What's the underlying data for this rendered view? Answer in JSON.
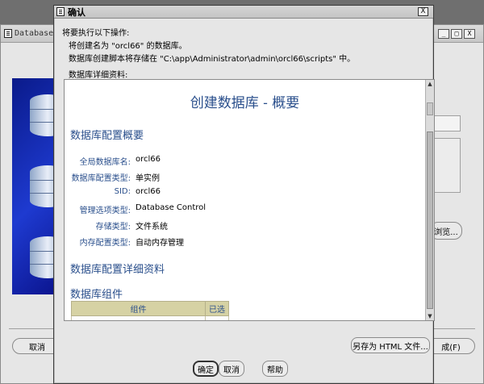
{
  "background_window": {
    "title": "Database",
    "window_controls": [
      "_",
      "□",
      "X"
    ],
    "browse_label": "浏览...",
    "cancel_label": "取消",
    "finish_label": "成(F)"
  },
  "dialog": {
    "title": "确认",
    "close_label": "X",
    "intro_line1": "将要执行以下操作:",
    "intro_line2": "将创建名为 \"orcl66\" 的数据库。",
    "intro_line3": "数据库创建脚本将存储在 \"C:\\app\\Administrator\\admin\\orcl66\\scripts\" 中。",
    "details_caption": "数据库详细资料:",
    "summary": {
      "title": "创建数据库 - 概要",
      "section1": "数据库配置概要",
      "rows": [
        {
          "key": "全局数据库名:",
          "value": "orcl66"
        },
        {
          "key": "数据库配置类型:",
          "value": "单实例"
        },
        {
          "key": "SID:",
          "value": "orcl66"
        },
        {
          "key": "管理选项类型:",
          "value": "Database Control"
        },
        {
          "key": "存储类型:",
          "value": "文件系统"
        },
        {
          "key": "内存配置类型:",
          "value": "自动内存管理"
        }
      ],
      "section2": "数据库配置详细资料",
      "section3": "数据库组件",
      "table_headers": [
        "组件",
        "已选"
      ]
    },
    "buttons": {
      "save_html": "另存为 HTML 文件...",
      "ok": "确定",
      "cancel": "取消",
      "help": "帮助"
    }
  },
  "colors": {
    "heading_blue": "#2a4f8c",
    "table_header_bg": "#d6d2a4"
  }
}
